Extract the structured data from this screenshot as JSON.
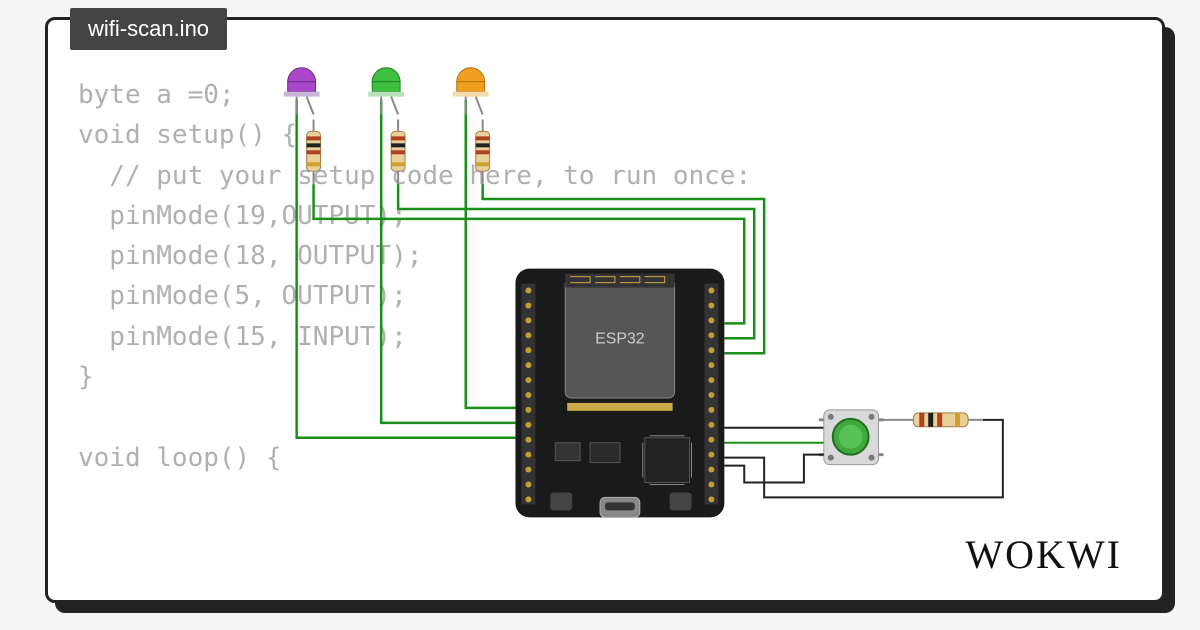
{
  "tab": {
    "filename": "wifi-scan.ino"
  },
  "code": {
    "line1": "byte a =0;",
    "line2": "void setup() {",
    "line3": "  // put your setup code here, to run once:",
    "line4": "  pinMode(19,OUTPUT);",
    "line5": "  pinMode(18, OUTPUT);",
    "line6": "  pinMode(5, OUTPUT);",
    "line7": "  pinMode(15, INPUT);",
    "line8": "}",
    "line9": "",
    "line10": "void loop() {"
  },
  "board": {
    "label": "ESP32"
  },
  "components": {
    "led1_color": "#a946c9",
    "led2_color": "#3fbf3f",
    "led3_color": "#f0a020",
    "button_color": "#3fa83f"
  },
  "logo": "WOKWI"
}
